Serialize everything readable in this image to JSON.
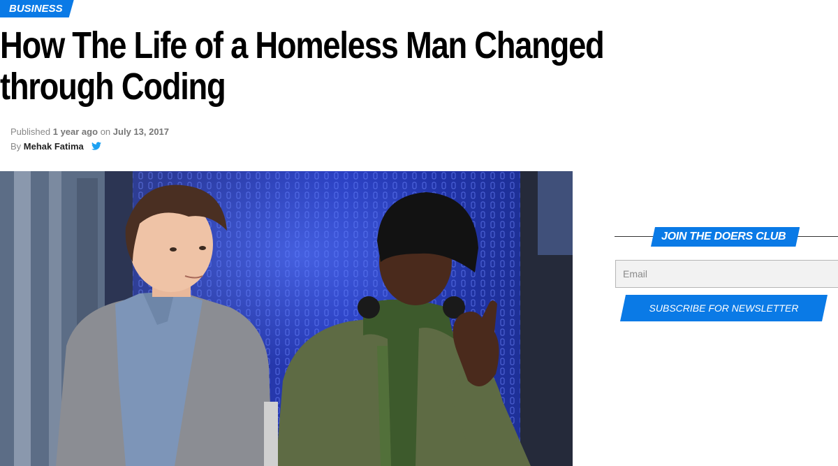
{
  "article": {
    "category": "BUSINESS",
    "title_line1": "How The Life of a Homeless Man Changed",
    "title_line2": "through Coding",
    "meta": {
      "published_prefix": "Published",
      "relative_time": "1 year ago",
      "on_word": "on",
      "date": "July 13, 2017",
      "by_word": "By",
      "author": "Mehak Fatima",
      "social_icon": "twitter-icon"
    },
    "hero_image": {
      "icon": "photo"
    }
  },
  "sidebar": {
    "club_heading": "JOIN THE DOERS CLUB",
    "email_placeholder": "Email",
    "subscribe_label": "SUBSCRIBE FOR NEWSLETTER"
  },
  "colors": {
    "accent": "#0a7ae6",
    "headline": "#000000",
    "meta_text": "#888888",
    "twitter": "#1da1f2"
  }
}
